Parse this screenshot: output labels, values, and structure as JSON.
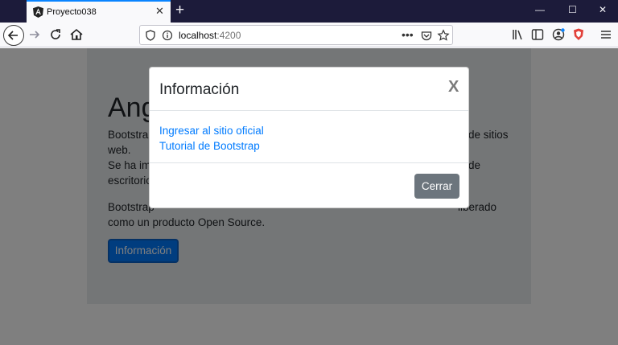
{
  "browser": {
    "tab_title": "Proyecto038",
    "url_host": "localhost",
    "url_port": ":4200"
  },
  "page": {
    "heading": "Ang",
    "paragraph1_lines": [
      "Bootstrap",
      "web.",
      "Se ha imp",
      "escritorio"
    ],
    "paragraph1_right": [
      "de sitios",
      "de"
    ],
    "paragraph2_lines": [
      "Bootstrap",
      "como un producto Open Source."
    ],
    "paragraph2_right": "liberado",
    "info_button": "Información"
  },
  "modal": {
    "title": "Información",
    "close_label": "X",
    "links": [
      "Ingresar al sitio oficial",
      "Tutorial de Bootstrap"
    ],
    "close_button": "Cerrar"
  },
  "colors": {
    "primary": "#007bff",
    "secondary": "#6c757d",
    "jumbotron": "#e9ecef",
    "tabbar": "#1c1b3a"
  }
}
